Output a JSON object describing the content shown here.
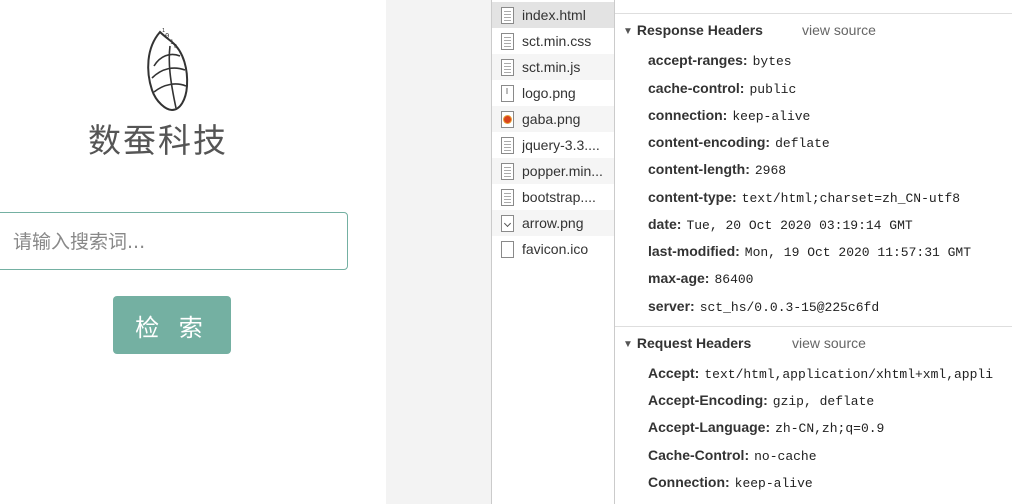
{
  "page": {
    "brand": "数蚕科技",
    "search_placeholder": "请输入搜索词...",
    "search_button": "检 索",
    "accent_color": "#74b0a2"
  },
  "files": [
    {
      "name": "index.html",
      "icon": "document-icon"
    },
    {
      "name": "sct.min.css",
      "icon": "document-icon"
    },
    {
      "name": "sct.min.js",
      "icon": "document-icon"
    },
    {
      "name": "logo.png",
      "icon": "image-icon"
    },
    {
      "name": "gaba.png",
      "icon": "image-icon"
    },
    {
      "name": "jquery-3.3....",
      "icon": "document-icon"
    },
    {
      "name": "popper.min...",
      "icon": "document-icon"
    },
    {
      "name": "bootstrap....",
      "icon": "document-icon"
    },
    {
      "name": "arrow.png",
      "icon": "image-icon"
    },
    {
      "name": "favicon.ico",
      "icon": "document-icon"
    }
  ],
  "response_headers": {
    "title": "Response Headers",
    "view_source": "view source",
    "rows": [
      {
        "name": "accept-ranges:",
        "value": "bytes"
      },
      {
        "name": "cache-control:",
        "value": "public"
      },
      {
        "name": "connection:",
        "value": "keep-alive"
      },
      {
        "name": "content-encoding:",
        "value": "deflate"
      },
      {
        "name": "content-length:",
        "value": "2968"
      },
      {
        "name": "content-type:",
        "value": "text/html;charset=zh_CN-utf8"
      },
      {
        "name": "date:",
        "value": "Tue, 20 Oct 2020 03:19:14 GMT"
      },
      {
        "name": "last-modified:",
        "value": "Mon, 19 Oct 2020 11:57:31 GMT"
      },
      {
        "name": "max-age:",
        "value": "86400"
      },
      {
        "name": "server:",
        "value": "sct_hs/0.0.3-15@225c6fd"
      }
    ]
  },
  "request_headers": {
    "title": "Request Headers",
    "view_source": "view source",
    "rows": [
      {
        "name": "Accept:",
        "value": "text/html,application/xhtml+xml,appli"
      },
      {
        "name": "Accept-Encoding:",
        "value": "gzip, deflate"
      },
      {
        "name": "Accept-Language:",
        "value": "zh-CN,zh;q=0.9"
      },
      {
        "name": "Cache-Control:",
        "value": "no-cache"
      },
      {
        "name": "Connection:",
        "value": "keep-alive"
      }
    ]
  }
}
